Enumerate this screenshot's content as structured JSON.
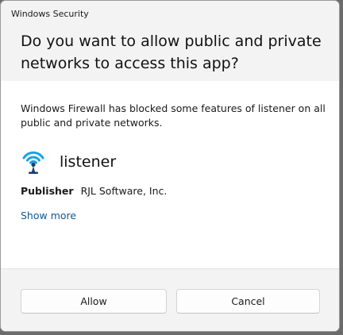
{
  "window": {
    "title": "Windows Security"
  },
  "dialog": {
    "heading": "Do you want to allow public and private networks to access this app?",
    "message": "Windows Firewall has blocked some features of listener on all public and private networks."
  },
  "app": {
    "name": "listener",
    "icon": "wifi-antenna-icon",
    "publisher_label": "Publisher",
    "publisher_value": "RJL Software, Inc."
  },
  "links": {
    "show_more": "Show more"
  },
  "buttons": {
    "allow": "Allow",
    "cancel": "Cancel"
  },
  "colors": {
    "link": "#0a5a96",
    "header_bg": "#f3f3f3",
    "icon_blue": "#1aa3e0"
  }
}
